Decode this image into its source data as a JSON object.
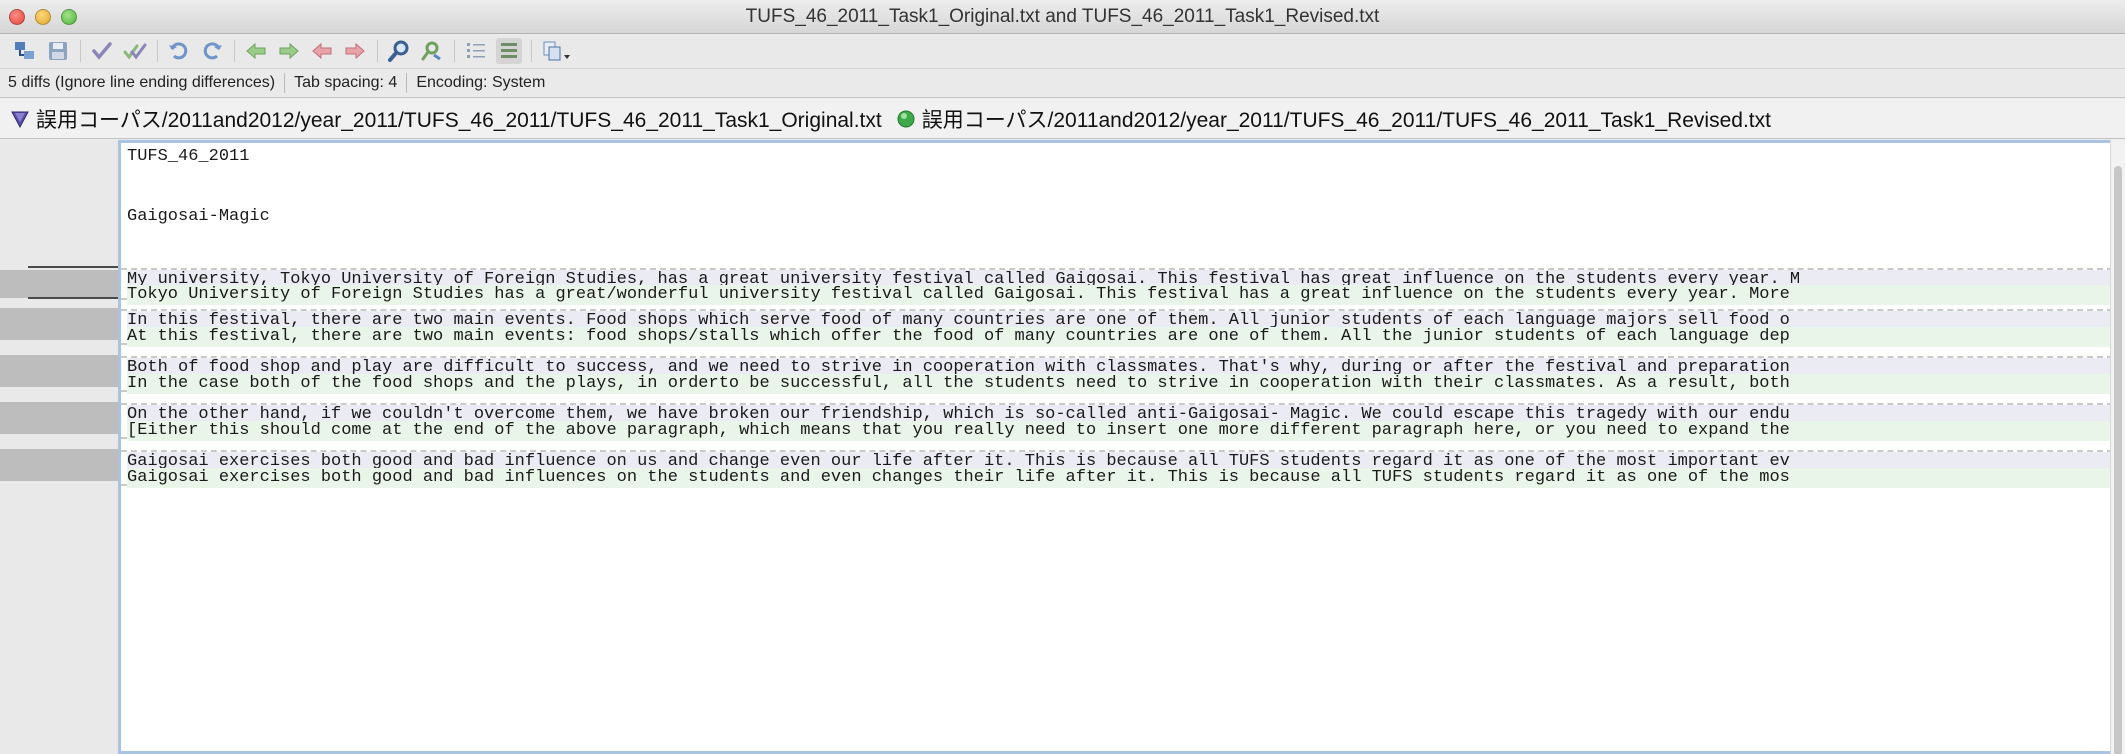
{
  "window": {
    "title": "TUFS_46_2011_Task1_Original.txt and TUFS_46_2011_Task1_Revised.txt"
  },
  "toolbar": {
    "buttons": [
      {
        "icon": "merge-icon"
      },
      {
        "icon": "save-icon"
      },
      {
        "icon": "check-icon"
      },
      {
        "icon": "check-all-icon"
      },
      {
        "icon": "undo-icon"
      },
      {
        "icon": "redo-icon"
      },
      {
        "icon": "arrow-left-icon"
      },
      {
        "icon": "arrow-right-icon"
      },
      {
        "icon": "arrow-left-red-icon"
      },
      {
        "icon": "arrow-right-red-icon"
      },
      {
        "icon": "find-icon"
      },
      {
        "icon": "find-next-icon"
      },
      {
        "icon": "list-icon"
      },
      {
        "icon": "list-selected-icon"
      },
      {
        "icon": "copy-dropdown-icon"
      }
    ]
  },
  "status": {
    "diffs": "5 diffs (Ignore line ending differences)",
    "tab_spacing": "Tab spacing: 4",
    "encoding": "Encoding: System"
  },
  "paths": {
    "original": "誤用コーパス/2011and2012/year_2011/TUFS_46_2011/TUFS_46_2011_Task1_Original.txt",
    "revised": "誤用コーパス/2011and2012/year_2011/TUFS_46_2011/TUFS_46_2011_Task1_Revised.txt"
  },
  "document": {
    "title_line": "TUFS_46_2011",
    "heading_line": "Gaigosai-Magic",
    "diffs": [
      {
        "original": "My university, Tokyo University of Foreign Studies, has a great university festival called Gaigosai. This festival has great influence on the students every year. M",
        "revised": "Tokyo University of Foreign Studies has a great/wonderful university festival called Gaigosai. This festival has a great influence on the students every year. More"
      },
      {
        "original": "In this festival, there are two main events. Food shops which serve food of many countries are one of them. All junior students of each language majors sell food o",
        "revised": "At this festival, there are two main events: food shops/stalls which offer the food of many countries are one of them. All the junior students of each language dep"
      },
      {
        "original": "Both of food shop and play are difficult to success, and we need to strive in cooperation with classmates. That's why, during or after the festival and preparation",
        "revised": "In the case both of the food shops and the plays, in orderto be successful, all the students need to strive in cooperation with their classmates. As a result, both"
      },
      {
        "original": "On the other hand, if we couldn't overcome them, we have broken our friendship, which is so-called anti-Gaigosai- Magic. We could escape this tragedy with our endu",
        "revised": "[Either this should come at the end of the above paragraph, which means that you really need to insert one more different paragraph here, or you need to expand the"
      },
      {
        "original": "Gaigosai exercises both good and bad influence on us and change even our life after it. This is because all TUFS students regard it as one of the most important ev",
        "revised": "Gaigosai exercises both good and bad influences on the students and even changes their life after it. This is because all TUFS students regard it as one of the mos"
      }
    ]
  }
}
